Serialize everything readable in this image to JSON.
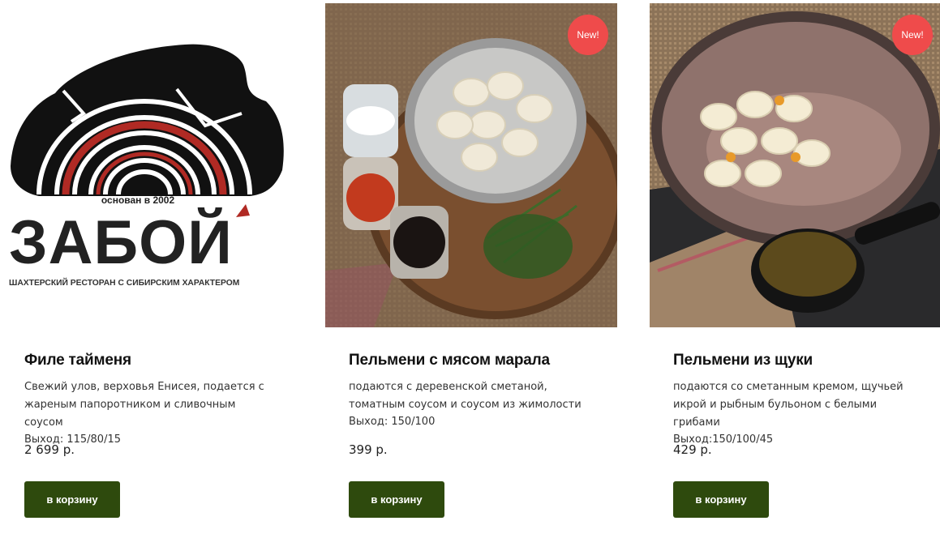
{
  "logo": {
    "founded": "основан в 2002",
    "name": "ЗАБОЙ",
    "tagline": "ШАХТЕРСКИЙ РЕСТОРАН С СИБИРСКИМ ХАРАКТЕРОМ"
  },
  "products": [
    {
      "title": "Филе тайменя",
      "description": "Свежий улов, верховья Енисея, подается с жареным папоротником и сливочным соусом",
      "yield": "Выход: 115/80/15",
      "price": "2 699 р.",
      "button": "в корзину"
    },
    {
      "badge": "New!",
      "title": "Пельмени с мясом марала",
      "description": "подаются с деревенской сметаной, томатным соусом и соусом из жимолости",
      "yield": "Выход: 150/100",
      "price": "399 р.",
      "button": "в корзину"
    },
    {
      "badge": "New!",
      "title": "Пельмени из щуки",
      "description": "подаются со сметанным кремом, щучьей икрой и рыбным бульоном с белыми грибами",
      "yield": "Выход:150/100/45",
      "price": "429 р.",
      "button": "в корзину"
    }
  ],
  "colors": {
    "badge": "#ef4b4b",
    "button": "#2e4a0d",
    "logo_red": "#b02a24"
  }
}
